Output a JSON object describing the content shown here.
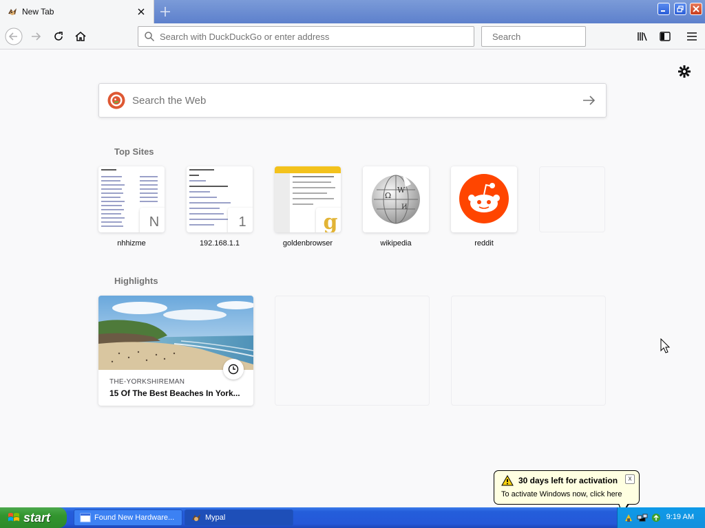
{
  "browser": {
    "tab_title": "New Tab",
    "url_placeholder": "Search with DuckDuckGo or enter address",
    "search_placeholder": "Search"
  },
  "newtab": {
    "web_search_placeholder": "Search the Web",
    "top_sites_title": "Top Sites",
    "top_sites": [
      {
        "label": "nhhizme",
        "badge": "N"
      },
      {
        "label": "192.168.1.1",
        "badge": "1"
      },
      {
        "label": "goldenbrowser",
        "badge": "g"
      },
      {
        "label": "wikipedia"
      },
      {
        "label": "reddit"
      },
      {
        "label": ""
      }
    ],
    "highlights_title": "Highlights",
    "highlights": [
      {
        "source": "THE-YORKSHIREMAN",
        "title": "15 Of The Best Beaches In York..."
      }
    ]
  },
  "notification": {
    "title": "30 days left for activation",
    "body": "To activate Windows now, click here",
    "close": "x"
  },
  "taskbar": {
    "start_label": "start",
    "tasks": [
      {
        "label": "Found New Hardware..."
      },
      {
        "label": "Mypal"
      }
    ],
    "clock": "9:19 AM"
  },
  "colors": {
    "titlebar": "#5d80cc",
    "taskbar": "#245edb",
    "start": "#32952e",
    "reddit": "#ff4500",
    "ddg": "#de5833"
  }
}
